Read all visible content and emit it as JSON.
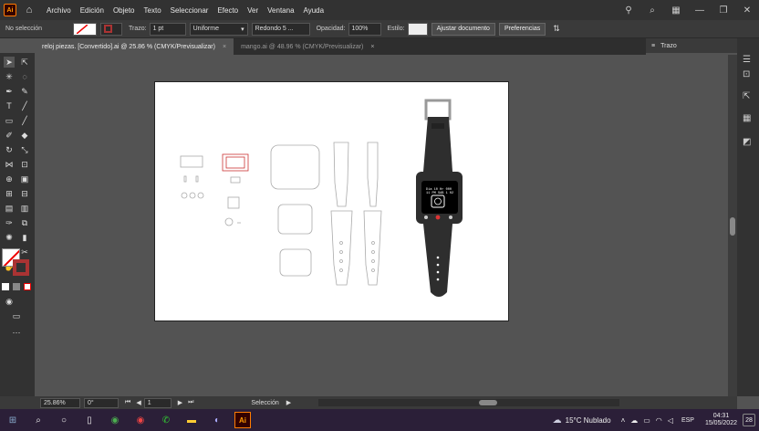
{
  "app": {
    "logo": "Ai",
    "menu": [
      "Archivo",
      "Edición",
      "Objeto",
      "Texto",
      "Seleccionar",
      "Efecto",
      "Ver",
      "Ventana",
      "Ayuda"
    ]
  },
  "control_bar": {
    "selection": "No selección",
    "trazo_label": "Trazo:",
    "trazo_value": "1 pt",
    "uniforme": "Uniforme",
    "brush": "Redondo 5 ...",
    "opacity_label": "Opacidad:",
    "opacity_value": "100%",
    "style_label": "Estilo:",
    "ajustar": "Ajustar documento",
    "preferencias": "Preferencias"
  },
  "tabs": [
    {
      "label": "reloj piezas. [Convertido].ai @ 25.86 % (CMYK/Previsualizar)",
      "close": "×"
    },
    {
      "label": "mango.ai @ 48.96 % (CMYK/Previsualizar)",
      "close": "×"
    }
  ],
  "panel": {
    "title": "Trazo"
  },
  "watch_screen": {
    "line1": "Dia 10 Hr 000",
    "line2": "11 PM  SAB 1 02"
  },
  "status": {
    "zoom": "25.86%",
    "rotation": "0°",
    "page": "1",
    "tool": "Selección"
  },
  "taskbar": {
    "weather": "15°C  Nublado",
    "lang": "ESP",
    "time": "04:31",
    "date": "15/05/2022",
    "badge": "28"
  },
  "colors": {
    "accent_ai": "#ff9a00",
    "artboard": "#ffffff",
    "canvas": "#535353",
    "watch": "#2e2e2e",
    "part_stroke": "#aaaaaa",
    "part_red": "#cc3333"
  }
}
